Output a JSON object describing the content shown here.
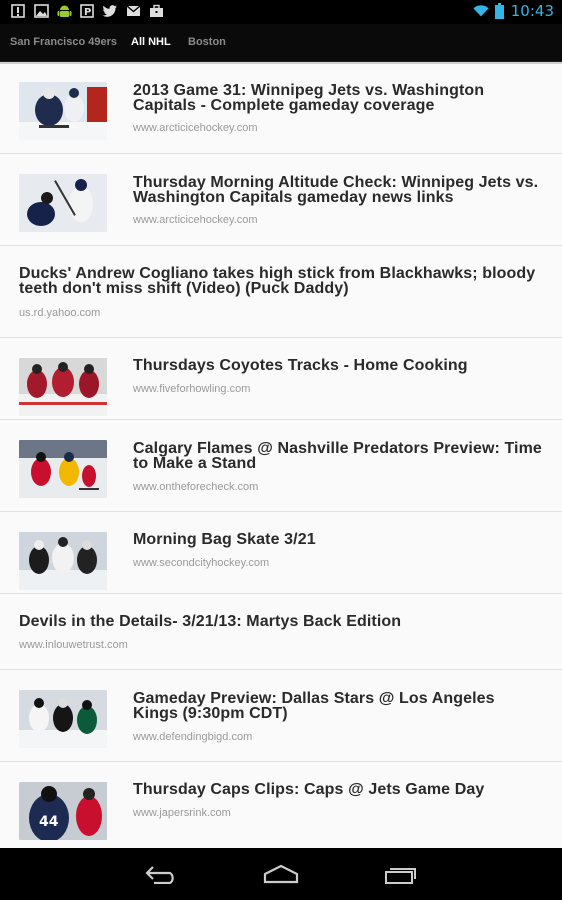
{
  "status_bar": {
    "time": "10:43",
    "left_icons": [
      "notification-icon",
      "image-icon",
      "android-icon",
      "pandora-icon",
      "twitter-icon",
      "email-icon",
      "briefcase-icon"
    ],
    "right_icons": [
      "wifi-icon",
      "battery-icon"
    ],
    "accent_color": "#33b5e5"
  },
  "tabs": [
    {
      "label": "San Francisco 49ers",
      "active": false
    },
    {
      "label": "All NHL",
      "active": true
    },
    {
      "label": "Boston",
      "active": false
    }
  ],
  "articles": [
    {
      "title": "2013 Game 31: Winnipeg Jets vs. Washington Capitals - Complete gameday coverage",
      "source": "www.arcticicehockey.com",
      "has_image": true
    },
    {
      "title": "Thursday Morning Altitude Check: Winnipeg Jets vs. Washington Capitals gameday news links",
      "source": "www.arcticicehockey.com",
      "has_image": true
    },
    {
      "title": "Ducks' Andrew Cogliano takes high stick from Blackhawks; bloody teeth don't miss shift (Video) (Puck Daddy)",
      "source": "us.rd.yahoo.com",
      "has_image": false
    },
    {
      "title": "Thursdays Coyotes Tracks - Home Cooking",
      "source": "www.fiveforhowling.com",
      "has_image": true
    },
    {
      "title": "Calgary Flames @ Nashville Predators Preview: Time to Make a Stand",
      "source": "www.ontheforecheck.com",
      "has_image": true
    },
    {
      "title": "Morning Bag Skate 3/21",
      "source": "www.secondcityhockey.com",
      "has_image": true
    },
    {
      "title": "Devils in the Details- 3/21/13: Martys Back Edition",
      "source": "www.inlouwetrust.com",
      "has_image": false
    },
    {
      "title": "Gameday Preview: Dallas Stars @ Los Angeles Kings (9:30pm CDT)",
      "source": "www.defendingbigd.com",
      "has_image": true
    },
    {
      "title": "Thursday Caps Clips: Caps @ Jets Game Day",
      "source": "www.japersrink.com",
      "has_image": true
    }
  ],
  "nav_bar": {
    "buttons": [
      "back-icon",
      "home-icon",
      "recent-apps-icon"
    ]
  }
}
